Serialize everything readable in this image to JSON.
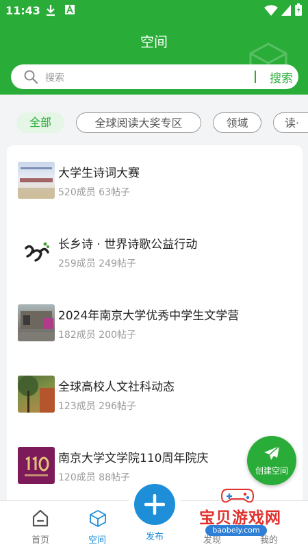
{
  "status_bar": {
    "time": "11:43"
  },
  "header": {
    "title": "空间"
  },
  "search": {
    "placeholder": "搜索",
    "button_label": "搜索"
  },
  "tabs": [
    {
      "label": "全部",
      "active": true
    },
    {
      "label": "全球阅读大奖专区",
      "active": false
    },
    {
      "label": "领域",
      "active": false
    },
    {
      "label": "读·",
      "active": false
    }
  ],
  "spaces": [
    {
      "name": "大学生诗词大赛",
      "meta": "520成员 63帖子",
      "thumb_icon": "poetry-contest-thumbnail"
    },
    {
      "name": "长乡诗 · 世界诗歌公益行动",
      "meta": "259成员 249帖子",
      "thumb_icon": "calligraphy-logo-thumbnail"
    },
    {
      "name": "2024年南京大学优秀中学生文学营",
      "meta": "182成员 200帖子",
      "thumb_icon": "campus-building-thumbnail"
    },
    {
      "name": "全球高校人文社科动态",
      "meta": "123成员 296帖子",
      "thumb_icon": "autumn-tree-thumbnail"
    },
    {
      "name": "南京大学文学院110周年院庆",
      "meta": "120成员 88帖子",
      "thumb_icon": "anniversary-110-thumbnail"
    }
  ],
  "fab": {
    "label": "创建空间",
    "icon": "paper-plane-icon"
  },
  "bottom_nav": {
    "home": "首页",
    "space": "空间",
    "publish": "发布",
    "discover": "发现",
    "mine": "我的"
  },
  "watermark": {
    "text": "宝贝游戏网",
    "url": "baobeiy.com"
  },
  "colors": {
    "brand_green": "#2aad38",
    "publish_blue": "#1e8ed9",
    "watermark_red": "#e0312d"
  }
}
